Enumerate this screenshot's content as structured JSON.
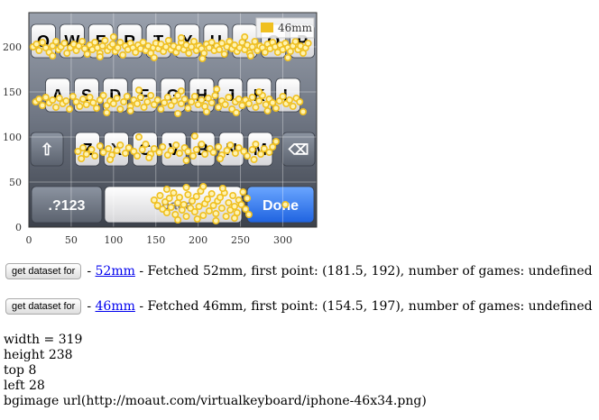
{
  "chart_data": {
    "type": "scatter",
    "title": "",
    "xlabel": "",
    "ylabel": "",
    "xlim": [
      0,
      340
    ],
    "ylim": [
      0,
      238
    ],
    "x_ticks": [
      "0",
      "50",
      "100",
      "150",
      "200",
      "250",
      "300"
    ],
    "y_ticks": [
      "0",
      "50",
      "100",
      "150",
      "200"
    ],
    "grid": true,
    "legend_position": "top-right",
    "background_image": "iphone keyboard (bgimage)",
    "series": [
      {
        "name": "46mm",
        "color": "#f0c020",
        "points": [
          [
            5,
            200
          ],
          [
            9,
            203
          ],
          [
            12,
            196
          ],
          [
            16,
            205
          ],
          [
            20,
            199
          ],
          [
            24,
            194
          ],
          [
            28,
            201
          ],
          [
            32,
            206
          ],
          [
            35,
            197
          ],
          [
            38,
            200
          ],
          [
            42,
            204
          ],
          [
            45,
            193
          ],
          [
            49,
            199
          ],
          [
            53,
            203
          ],
          [
            56,
            196
          ],
          [
            59,
            201
          ],
          [
            63,
            206
          ],
          [
            66,
            198
          ],
          [
            69,
            192
          ],
          [
            72,
            202
          ],
          [
            75,
            197
          ],
          [
            78,
            205
          ],
          [
            81,
            199
          ],
          [
            84,
            193
          ],
          [
            87,
            201
          ],
          [
            90,
            207
          ],
          [
            93,
            196
          ],
          [
            96,
            200
          ],
          [
            99,
            203
          ],
          [
            102,
            195
          ],
          [
            105,
            199
          ],
          [
            108,
            205
          ],
          [
            111,
            191
          ],
          [
            114,
            201
          ],
          [
            117,
            197
          ],
          [
            120,
            204
          ],
          [
            123,
            199
          ],
          [
            126,
            194
          ],
          [
            129,
            202
          ],
          [
            132,
            198
          ],
          [
            135,
            205
          ],
          [
            138,
            196
          ],
          [
            141,
            201
          ],
          [
            144,
            193
          ],
          [
            147,
            199
          ],
          [
            150,
            204
          ],
          [
            153,
            198
          ],
          [
            156,
            203
          ],
          [
            159,
            195
          ],
          [
            162,
            200
          ],
          [
            165,
            207
          ],
          [
            168,
            197
          ],
          [
            171,
            201
          ],
          [
            174,
            194
          ],
          [
            177,
            199
          ],
          [
            180,
            205
          ],
          [
            183,
            197
          ],
          [
            186,
            202
          ],
          [
            189,
            193
          ],
          [
            192,
            200
          ],
          [
            195,
            206
          ],
          [
            198,
            196
          ],
          [
            201,
            201
          ],
          [
            204,
            198
          ],
          [
            207,
            193
          ],
          [
            210,
            203
          ],
          [
            213,
            199
          ],
          [
            216,
            205
          ],
          [
            219,
            196
          ],
          [
            222,
            201
          ],
          [
            225,
            197
          ],
          [
            228,
            204
          ],
          [
            231,
            192
          ],
          [
            234,
            200
          ],
          [
            237,
            206
          ],
          [
            240,
            198
          ],
          [
            243,
            202
          ],
          [
            246,
            195
          ],
          [
            249,
            199
          ],
          [
            252,
            205
          ],
          [
            255,
            197
          ],
          [
            258,
            202
          ],
          [
            261,
            193
          ],
          [
            264,
            200
          ],
          [
            267,
            206
          ],
          [
            270,
            196
          ],
          [
            273,
            201
          ],
          [
            276,
            199
          ],
          [
            279,
            194
          ],
          [
            282,
            203
          ],
          [
            285,
            198
          ],
          [
            288,
            205
          ],
          [
            291,
            200
          ],
          [
            294,
            194
          ],
          [
            297,
            202
          ],
          [
            300,
            197
          ],
          [
            303,
            204
          ],
          [
            306,
            199
          ],
          [
            309,
            195
          ],
          [
            312,
            201
          ],
          [
            315,
            206
          ],
          [
            318,
            197
          ],
          [
            321,
            201
          ],
          [
            324,
            193
          ],
          [
            327,
            199
          ],
          [
            330,
            204
          ],
          [
            28,
            190
          ],
          [
            84,
            189
          ],
          [
            148,
            188
          ],
          [
            205,
            187
          ],
          [
            262,
            190
          ],
          [
            306,
            188
          ],
          [
            100,
            211
          ],
          [
            180,
            210
          ],
          [
            255,
            211
          ],
          [
            8,
            139
          ],
          [
            12,
            142
          ],
          [
            16,
            135
          ],
          [
            20,
            144
          ],
          [
            24,
            138
          ],
          [
            28,
            141
          ],
          [
            32,
            133
          ],
          [
            36,
            143
          ],
          [
            40,
            137
          ],
          [
            44,
            140
          ],
          [
            48,
            131
          ],
          [
            52,
            145
          ],
          [
            56,
            139
          ],
          [
            60,
            134
          ],
          [
            64,
            142
          ],
          [
            68,
            136
          ],
          [
            72,
            144
          ],
          [
            76,
            138
          ],
          [
            80,
            132
          ],
          [
            84,
            141
          ],
          [
            88,
            146
          ],
          [
            92,
            135
          ],
          [
            96,
            140
          ],
          [
            100,
            137
          ],
          [
            104,
            143
          ],
          [
            108,
            131
          ],
          [
            112,
            139
          ],
          [
            116,
            145
          ],
          [
            120,
            134
          ],
          [
            124,
            141
          ],
          [
            128,
            137
          ],
          [
            132,
            144
          ],
          [
            136,
            133
          ],
          [
            140,
            139
          ],
          [
            144,
            146
          ],
          [
            148,
            136
          ],
          [
            152,
            141
          ],
          [
            156,
            131
          ],
          [
            160,
            138
          ],
          [
            164,
            144
          ],
          [
            168,
            135
          ],
          [
            172,
            140
          ],
          [
            176,
            146
          ],
          [
            180,
            137
          ],
          [
            184,
            142
          ],
          [
            188,
            132
          ],
          [
            192,
            139
          ],
          [
            196,
            145
          ],
          [
            200,
            136
          ],
          [
            204,
            141
          ],
          [
            208,
            134
          ],
          [
            212,
            143
          ],
          [
            216,
            138
          ],
          [
            220,
            146
          ],
          [
            224,
            133
          ],
          [
            228,
            140
          ],
          [
            232,
            136
          ],
          [
            236,
            144
          ],
          [
            240,
            131
          ],
          [
            244,
            139
          ],
          [
            248,
            142
          ],
          [
            252,
            135
          ],
          [
            256,
            141
          ],
          [
            260,
            137
          ],
          [
            264,
            144
          ],
          [
            268,
            133
          ],
          [
            272,
            140
          ],
          [
            276,
            146
          ],
          [
            280,
            136
          ],
          [
            284,
            142
          ],
          [
            288,
            138
          ],
          [
            292,
            132
          ],
          [
            296,
            140
          ],
          [
            300,
            145
          ],
          [
            304,
            137
          ],
          [
            308,
            141
          ],
          [
            312,
            134
          ],
          [
            316,
            143
          ],
          [
            320,
            139
          ],
          [
            324,
            128
          ],
          [
            92,
            127
          ],
          [
            120,
            129
          ],
          [
            176,
            126
          ],
          [
            210,
            128
          ],
          [
            245,
            127
          ],
          [
            282,
            129
          ],
          [
            130,
            152
          ],
          [
            180,
            151
          ],
          [
            222,
            153
          ],
          [
            272,
            150
          ],
          [
            58,
            84
          ],
          [
            64,
            88
          ],
          [
            68,
            81
          ],
          [
            74,
            86
          ],
          [
            78,
            79
          ],
          [
            84,
            90
          ],
          [
            88,
            83
          ],
          [
            94,
            87
          ],
          [
            98,
            80
          ],
          [
            104,
            85
          ],
          [
            108,
            91
          ],
          [
            114,
            82
          ],
          [
            118,
            88
          ],
          [
            124,
            84
          ],
          [
            128,
            79
          ],
          [
            134,
            86
          ],
          [
            138,
            92
          ],
          [
            144,
            81
          ],
          [
            148,
            87
          ],
          [
            154,
            83
          ],
          [
            158,
            89
          ],
          [
            164,
            80
          ],
          [
            168,
            85
          ],
          [
            174,
            91
          ],
          [
            178,
            82
          ],
          [
            184,
            88
          ],
          [
            188,
            84
          ],
          [
            194,
            79
          ],
          [
            198,
            86
          ],
          [
            204,
            92
          ],
          [
            208,
            81
          ],
          [
            214,
            87
          ],
          [
            218,
            83
          ],
          [
            224,
            89
          ],
          [
            228,
            80
          ],
          [
            234,
            85
          ],
          [
            238,
            91
          ],
          [
            244,
            82
          ],
          [
            248,
            88
          ],
          [
            254,
            84
          ],
          [
            258,
            79
          ],
          [
            264,
            86
          ],
          [
            268,
            92
          ],
          [
            274,
            81
          ],
          [
            278,
            87
          ],
          [
            284,
            83
          ],
          [
            288,
            89
          ],
          [
            292,
            95
          ],
          [
            62,
            76
          ],
          [
            96,
            75
          ],
          [
            142,
            77
          ],
          [
            186,
            74
          ],
          [
            226,
            76
          ],
          [
            266,
            75
          ],
          [
            130,
            100
          ],
          [
            196,
            101
          ],
          [
            148,
            30
          ],
          [
            152,
            24
          ],
          [
            155,
            35
          ],
          [
            158,
            20
          ],
          [
            161,
            28
          ],
          [
            163,
            16
          ],
          [
            166,
            32
          ],
          [
            168,
            22
          ],
          [
            171,
            38
          ],
          [
            173,
            14
          ],
          [
            176,
            27
          ],
          [
            178,
            33
          ],
          [
            181,
            19
          ],
          [
            183,
            25
          ],
          [
            186,
            12
          ],
          [
            188,
            36
          ],
          [
            191,
            21
          ],
          [
            193,
            29
          ],
          [
            196,
            17
          ],
          [
            198,
            34
          ],
          [
            201,
            23
          ],
          [
            203,
            40
          ],
          [
            206,
            13
          ],
          [
            208,
            26
          ],
          [
            211,
            31
          ],
          [
            213,
            18
          ],
          [
            216,
            37
          ],
          [
            218,
            24
          ],
          [
            221,
            15
          ],
          [
            223,
            29
          ],
          [
            226,
            33
          ],
          [
            228,
            21
          ],
          [
            231,
            38
          ],
          [
            233,
            12
          ],
          [
            236,
            27
          ],
          [
            238,
            19
          ],
          [
            241,
            35
          ],
          [
            243,
            23
          ],
          [
            246,
            16
          ],
          [
            248,
            30
          ],
          [
            251,
            25
          ],
          [
            253,
            39
          ],
          [
            256,
            20
          ],
          [
            258,
            32
          ],
          [
            260,
            14
          ],
          [
            163,
            42
          ],
          [
            186,
            44
          ],
          [
            206,
            45
          ],
          [
            229,
            43
          ],
          [
            176,
            8
          ],
          [
            199,
            9
          ],
          [
            221,
            7
          ],
          [
            243,
            10
          ],
          [
            303,
            25
          ]
        ]
      }
    ]
  },
  "datasets": [
    {
      "button_label": "get dataset for",
      "sep": "-",
      "link_label": "52mm",
      "status": "- Fetched 52mm, first point: (181.5, 192), number of games: undefined"
    },
    {
      "button_label": "get dataset for",
      "sep": "-",
      "link_label": "46mm",
      "status": "- Fetched 46mm, first point: (154.5, 197), number of games: undefined"
    }
  ],
  "info": {
    "width": "width = 319",
    "height": "height 238",
    "top": "top 8",
    "left": "left 28",
    "bgimage": "bgimage url(http://moaut.com/virtualkeyboard/iphone-46x34.png)"
  },
  "keyboard": {
    "row1": [
      "Q",
      "W",
      "E",
      "R",
      "T",
      "Y",
      "U",
      "I",
      "O",
      "P"
    ],
    "row2": [
      "A",
      "S",
      "D",
      "F",
      "G",
      "H",
      "J",
      "K",
      "L"
    ],
    "row3": [
      "Z",
      "X",
      "C",
      "V",
      "B",
      "N",
      "M"
    ],
    "numbers_key": ".?123",
    "space_key": "space",
    "done_key": "Done"
  }
}
